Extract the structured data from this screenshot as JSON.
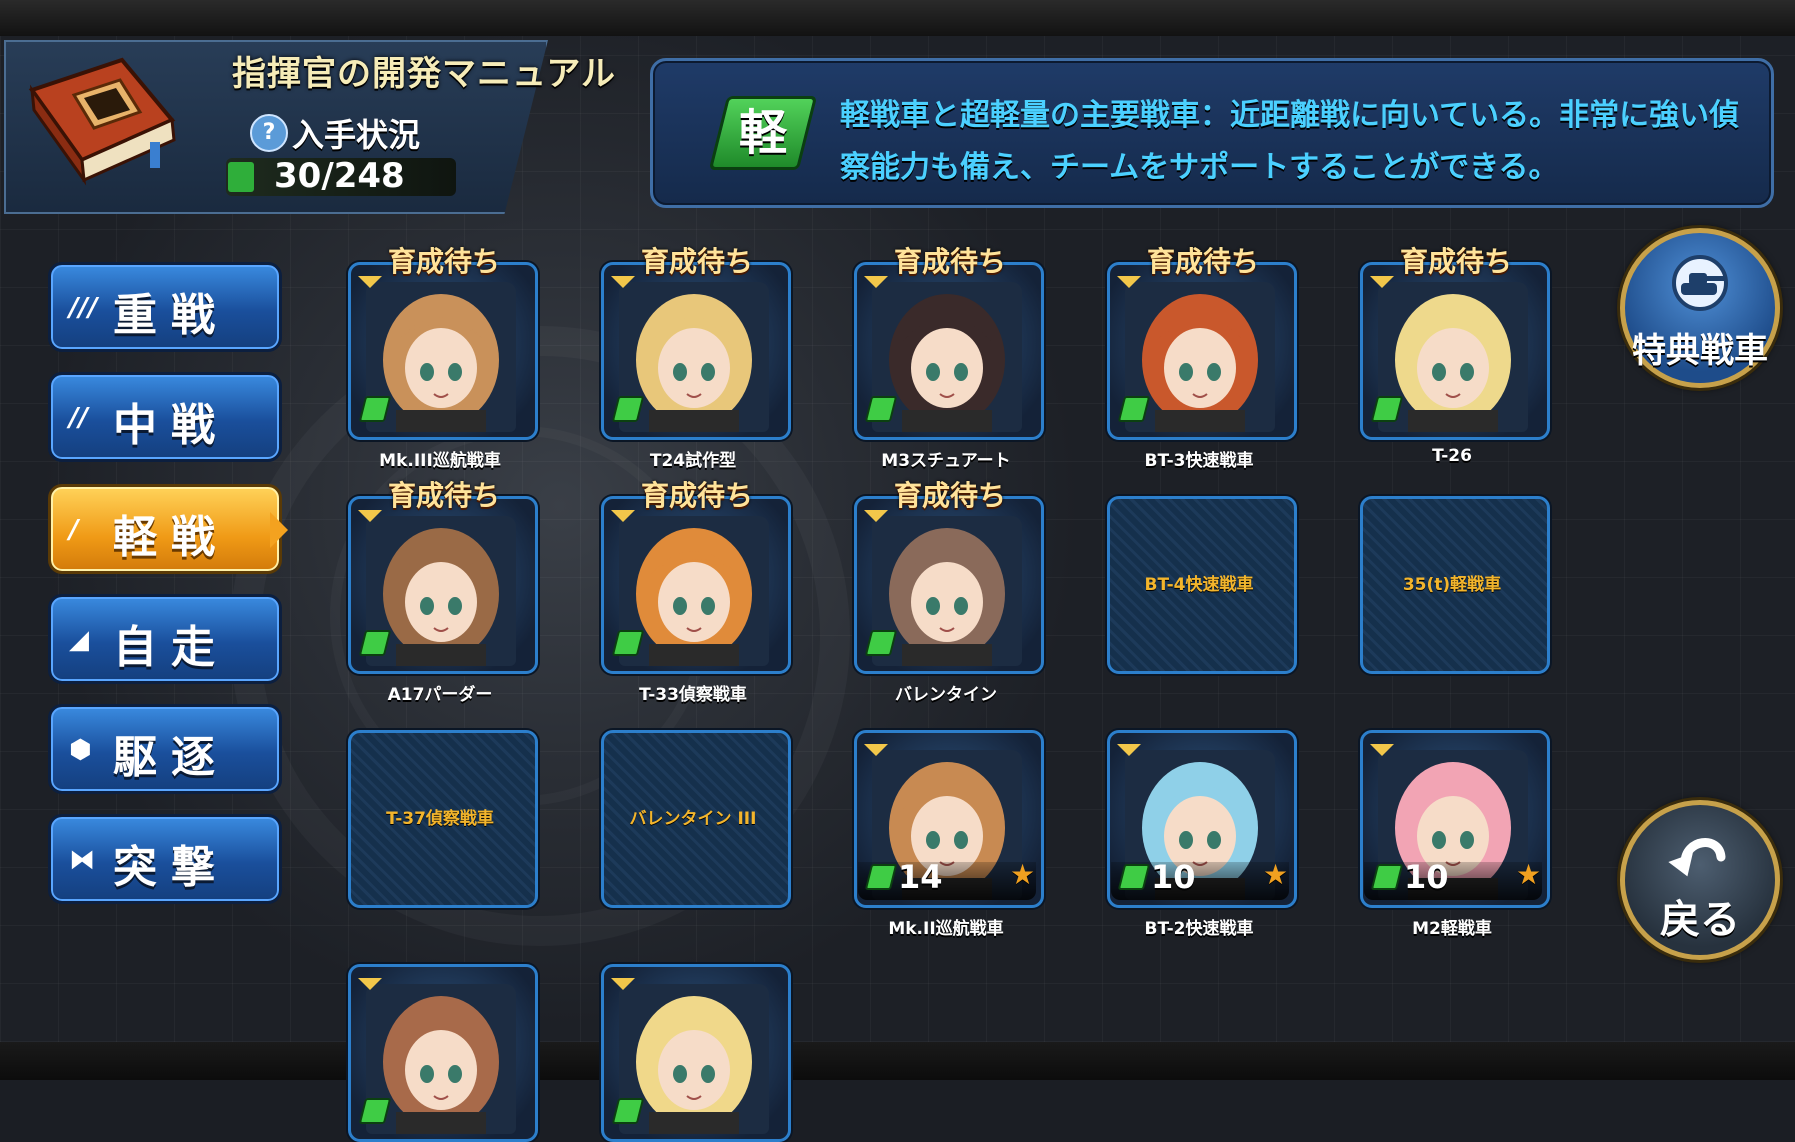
{
  "header": {
    "title": "指揮官の開発マニュアル",
    "status_label": "入手状況",
    "help_icon": "?",
    "count": "30/248"
  },
  "description": {
    "badge": "軽",
    "text": "軽戦車と超軽量の主要戦車：近距離戦に向いている。非常に強い偵察能力も備え、チームをサポートすることができる。"
  },
  "categories": [
    {
      "icon": "///",
      "label": "重戦",
      "active": false
    },
    {
      "icon": "//",
      "label": "中戦",
      "active": false
    },
    {
      "icon": "/",
      "label": "軽戦",
      "active": true
    },
    {
      "icon": "◢",
      "label": "自走",
      "active": false
    },
    {
      "icon": "⬢",
      "label": "駆逐",
      "active": false
    },
    {
      "icon": "⧓",
      "label": "突撃",
      "active": false
    }
  ],
  "cards": [
    {
      "name": "Mk.III巡航戦車",
      "status": "育成待ち",
      "owned": true,
      "hair": "#c9915a"
    },
    {
      "name": "T24試作型",
      "status": "育成待ち",
      "owned": true,
      "hair": "#e8c77a"
    },
    {
      "name": "M3スチュアート",
      "status": "育成待ち",
      "owned": true,
      "hair": "#3a2a2a"
    },
    {
      "name": "BT-3快速戦車",
      "status": "育成待ち",
      "owned": true,
      "hair": "#c9582c"
    },
    {
      "name": "T-26",
      "status": "育成待ち",
      "owned": true,
      "hair": "#eed98c"
    },
    {
      "name": "A17パーダー",
      "status": "育成待ち",
      "owned": true,
      "hair": "#9a6a46"
    },
    {
      "name": "T-33偵察戦車",
      "status": "育成待ち",
      "owned": true,
      "hair": "#e08b3a"
    },
    {
      "name": "バレンタイン",
      "status": "育成待ち",
      "owned": true,
      "hair": "#8a6a5a"
    },
    {
      "name": "BT-4快速戦車",
      "owned": false
    },
    {
      "name": "35(t)軽戦車",
      "owned": false
    },
    {
      "name": "T-37偵察戦車",
      "owned": false
    },
    {
      "name": "バレンタイン III",
      "owned": false
    },
    {
      "name": "Mk.II巡航戦車",
      "owned": true,
      "level": "14",
      "hair": "#c88a52"
    },
    {
      "name": "BT-2快速戦車",
      "owned": true,
      "level": "10",
      "hair": "#8fd0e8"
    },
    {
      "name": "M2軽戦車",
      "owned": true,
      "level": "10",
      "hair": "#f2a4b4"
    },
    {
      "name": "",
      "owned": true,
      "hair": "#a86a4a"
    },
    {
      "name": "",
      "owned": true,
      "hair": "#f0d88a"
    }
  ],
  "buttons": {
    "special_label": "特典戦車",
    "back_label": "戻る"
  }
}
